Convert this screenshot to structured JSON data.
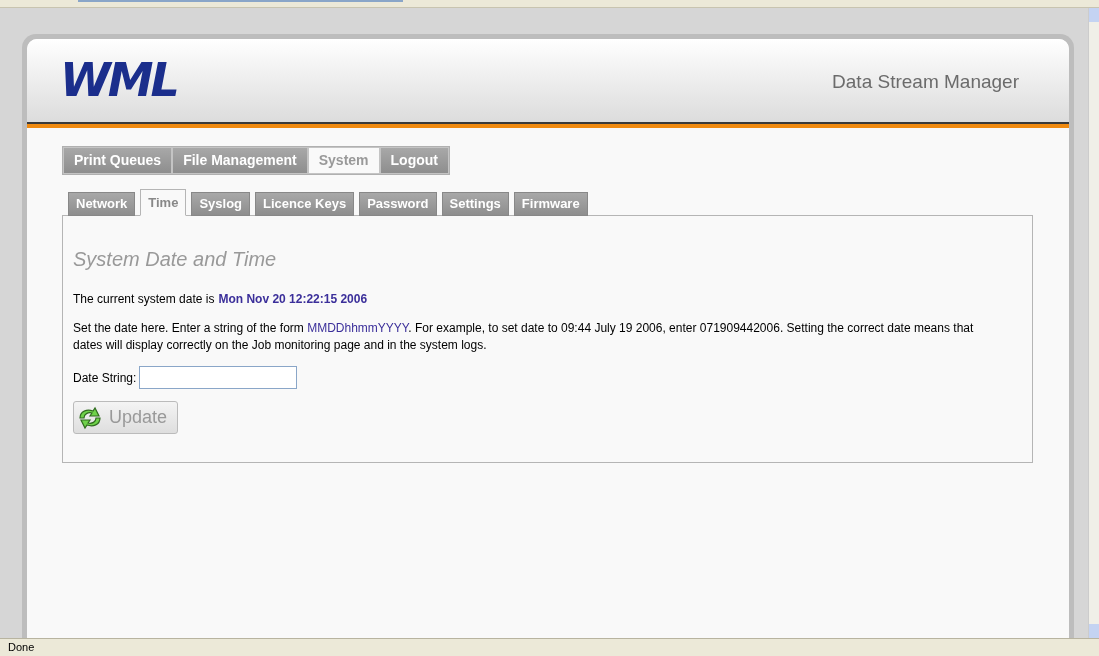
{
  "header": {
    "logo": "WML",
    "app_title": "Data Stream Manager"
  },
  "main_tabs": [
    {
      "label": "Print Queues",
      "selected": false
    },
    {
      "label": "File Management",
      "selected": false
    },
    {
      "label": "System",
      "selected": true
    },
    {
      "label": "Logout",
      "selected": false
    }
  ],
  "sub_tabs": [
    {
      "label": "Network",
      "selected": false
    },
    {
      "label": "Time",
      "selected": true
    },
    {
      "label": "Syslog",
      "selected": false
    },
    {
      "label": "Licence Keys",
      "selected": false
    },
    {
      "label": "Password",
      "selected": false
    },
    {
      "label": "Settings",
      "selected": false
    },
    {
      "label": "Firmware",
      "selected": false
    }
  ],
  "panel": {
    "heading": "System Date and Time",
    "current_date_label": "The current system date is",
    "current_date": "Mon Nov 20 12:22:15 2006",
    "help_before": "Set the date here. Enter a string of the form",
    "help_format": "MMDDhhmmYYYY",
    "help_after": ". For example, to set date to 09:44 July 19 2006, enter 071909442006. Setting the correct date means that dates will display correctly on the Job monitoring page and in the system logs.",
    "field_label": "Date String:",
    "button": "Update"
  },
  "status_bar": "Done"
}
